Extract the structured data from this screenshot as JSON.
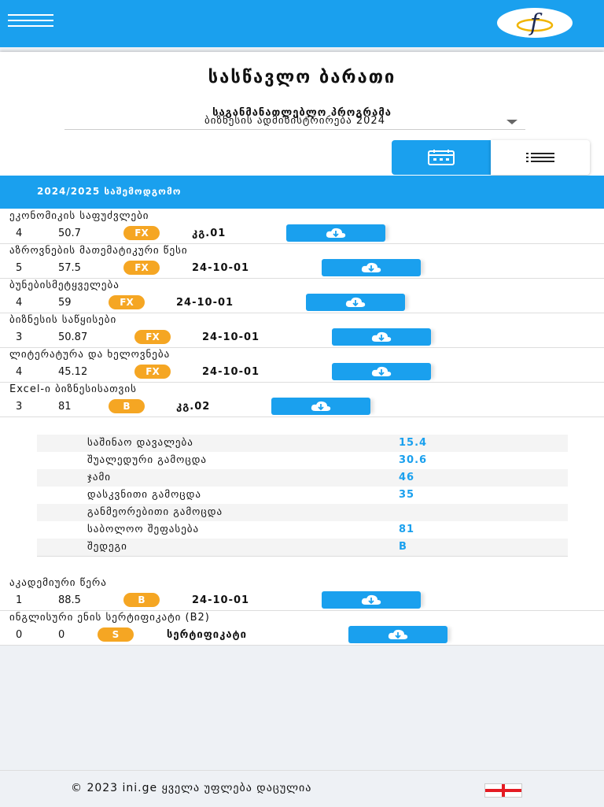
{
  "header": {
    "menu_icon": "hamburger-icon",
    "logo_glyph": "f"
  },
  "page": {
    "title": "სასწავლო ბარათი",
    "program_label": "საგანმანათლებლო პროგრამა",
    "program_value": "ბიზნესის ადმინისტრირება 2024",
    "view_toggle": {
      "calendar_icon": "calendar-icon",
      "list_icon": "list-icon"
    }
  },
  "semester": {
    "title": "2024/2025 საშემოდგომო"
  },
  "courses": [
    {
      "name": "ეკონომიკის საფუძვლები",
      "credits": "4",
      "score": "50.7",
      "grade": "FX",
      "date": "კგ.01"
    },
    {
      "name": "აზროვნების მათემატიკური წესი",
      "credits": "5",
      "score": "57.5",
      "grade": "FX",
      "date": "24-10-01"
    },
    {
      "name": "ბუნებისმეტყველება",
      "credits": "4",
      "score": "59",
      "grade": "FX",
      "date": "24-10-01"
    },
    {
      "name": "ბიზნესის საწყისები",
      "credits": "3",
      "score": "50.87",
      "grade": "FX",
      "date": "24-10-01"
    },
    {
      "name": "ლიტერატურა და ხელოვნება",
      "credits": "4",
      "score": "45.12",
      "grade": "FX",
      "date": "24-10-01"
    },
    {
      "name": "Excel-ი ბიზნესისათვის",
      "credits": "3",
      "score": "81",
      "grade": "B",
      "date": "კგ.02"
    }
  ],
  "details": [
    {
      "label": "საშინაო დავალება",
      "value": "15.4"
    },
    {
      "label": "შუალედური გამოცდა",
      "value": "30.6"
    },
    {
      "label": "ჯამი",
      "value": "46"
    },
    {
      "label": "დასკვნითი გამოცდა",
      "value": "35"
    },
    {
      "label": "განმეორებითი გამოცდა",
      "value": ""
    },
    {
      "label": "საბოლოო შეფასება",
      "value": "81"
    },
    {
      "label": "შედეგი",
      "value": "B"
    }
  ],
  "courses2": [
    {
      "name": "აკადემიური წერა",
      "credits": "1",
      "score": "88.5",
      "grade": "B",
      "date": "24-10-01"
    },
    {
      "name": "ინგლისური ენის სერტიფიკატი (B2)",
      "credits": "0",
      "score": "0",
      "grade": "S",
      "date": "სერტიფიკატი"
    }
  ],
  "footer": {
    "text": "© 2023 ini.ge ყველა უფლება დაცულია"
  },
  "colors": {
    "primary": "#1aa0ee",
    "badge": "#f5a623"
  }
}
